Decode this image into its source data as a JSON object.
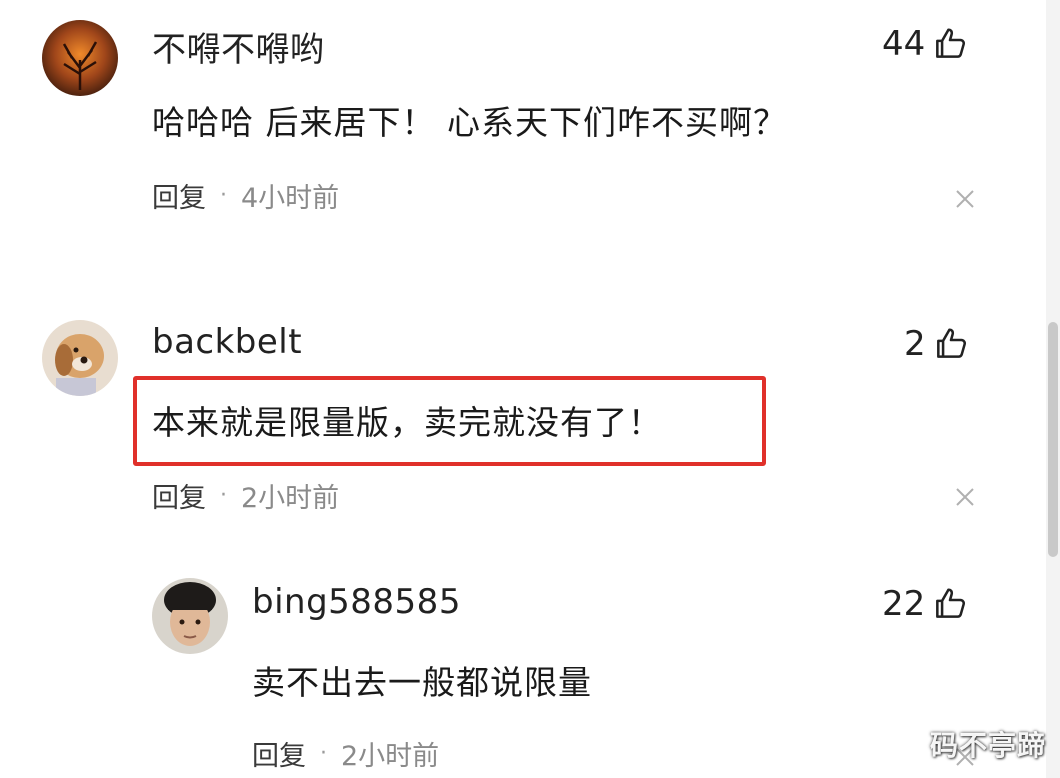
{
  "comments": [
    {
      "username": "不嘚不嘚哟",
      "text": "哈哈哈 后来居下！ 心系天下们咋不买啊？",
      "reply_label": "回复",
      "separator": "·",
      "time": "4小时前",
      "likes": "44"
    },
    {
      "username": "backbelt",
      "text": "本来就是限量版，卖完就没有了！",
      "reply_label": "回复",
      "separator": "·",
      "time": "2小时前",
      "likes": "2"
    },
    {
      "username": "bing588585",
      "text": "卖不出去一般都说限量",
      "reply_label": "回复",
      "separator": "·",
      "time": "2小时前",
      "likes": "22"
    }
  ],
  "watermark": "码不亭蹄",
  "colors": {
    "highlight_border": "#e0302a",
    "meta_text": "#8a8a8a",
    "main_text": "#1a1a1a"
  },
  "icons": {
    "like": "thumbs-up-icon",
    "close": "close-icon"
  }
}
